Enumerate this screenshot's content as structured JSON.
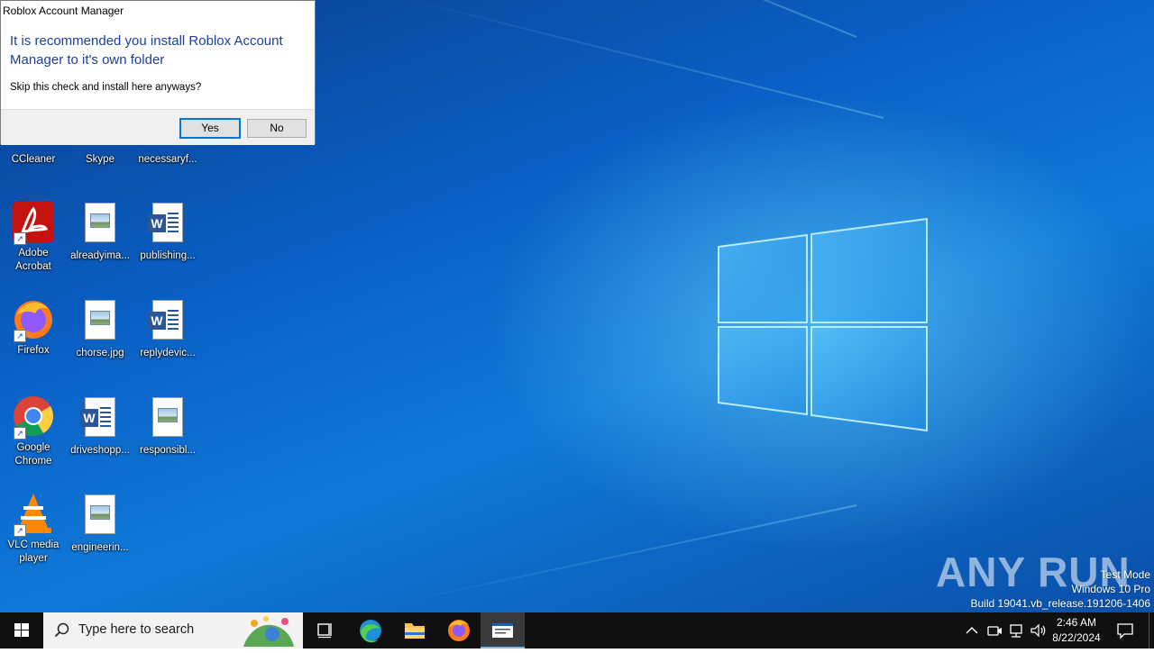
{
  "dialog": {
    "title": "Roblox Account Manager",
    "message": "It is recommended you install Roblox Account Manager to it's own folder",
    "question": "Skip this check and install here anyways?",
    "yes_label": "Yes",
    "no_label": "No"
  },
  "desktop_icons": {
    "ccleaner": "CCleaner",
    "skype": "Skype",
    "necessary": "necessaryf...",
    "acrobat": "Adobe Acrobat",
    "alreadyima": "alreadyima...",
    "publishing": "publishing...",
    "firefox": "Firefox",
    "chorse": "chorse.jpg",
    "replydevic": "replydevic...",
    "chrome": "Google Chrome",
    "driveshopp": "driveshopp...",
    "responsibl": "responsibl...",
    "vlc": "VLC media player",
    "engineerin": "engineerin..."
  },
  "watermark": {
    "line1": "Test Mode",
    "line2": "Windows 10 Pro",
    "line3": "Build 19041.vb_release.191206-1406",
    "brand": "ANY RUN"
  },
  "taskbar": {
    "search_placeholder": "Type here to search",
    "time": "2:46 AM",
    "date": "8/22/2024"
  },
  "colors": {
    "accent": "#0078d7",
    "dialog_message": "#1c3f9a",
    "taskbar": "#101010"
  }
}
